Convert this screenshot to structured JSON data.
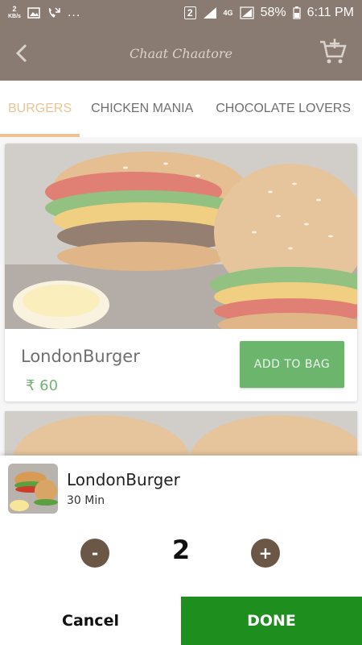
{
  "status_bar": {
    "kb_value": "2",
    "kb_unit": "KB/s",
    "sim_slot": "2",
    "network": "4G",
    "battery": "58%",
    "time": "6:11 PM",
    "more": "..."
  },
  "app_bar": {
    "title": "Chaat Chaatore",
    "back_icon": "chevron-left-icon",
    "cart_icon": "add-to-cart-icon"
  },
  "tabs": [
    {
      "label": "BURGERS",
      "active": true
    },
    {
      "label": "CHICKEN MANIA",
      "active": false
    },
    {
      "label": "CHOCOLATE LOVERS",
      "active": false
    }
  ],
  "product": {
    "name": "LondonBurger",
    "price": "₹ 60",
    "add_label": "ADD TO BAG"
  },
  "sheet": {
    "name": "LondonBurger",
    "time": "30 Min",
    "quantity": "2",
    "minus_label": "-",
    "plus_label": "+",
    "cancel_label": "Cancel",
    "done_label": "DONE"
  },
  "colors": {
    "primary": "#4a3525",
    "accent": "#e0a45a",
    "green": "#1e8e1e",
    "stepper": "#6b5745"
  }
}
